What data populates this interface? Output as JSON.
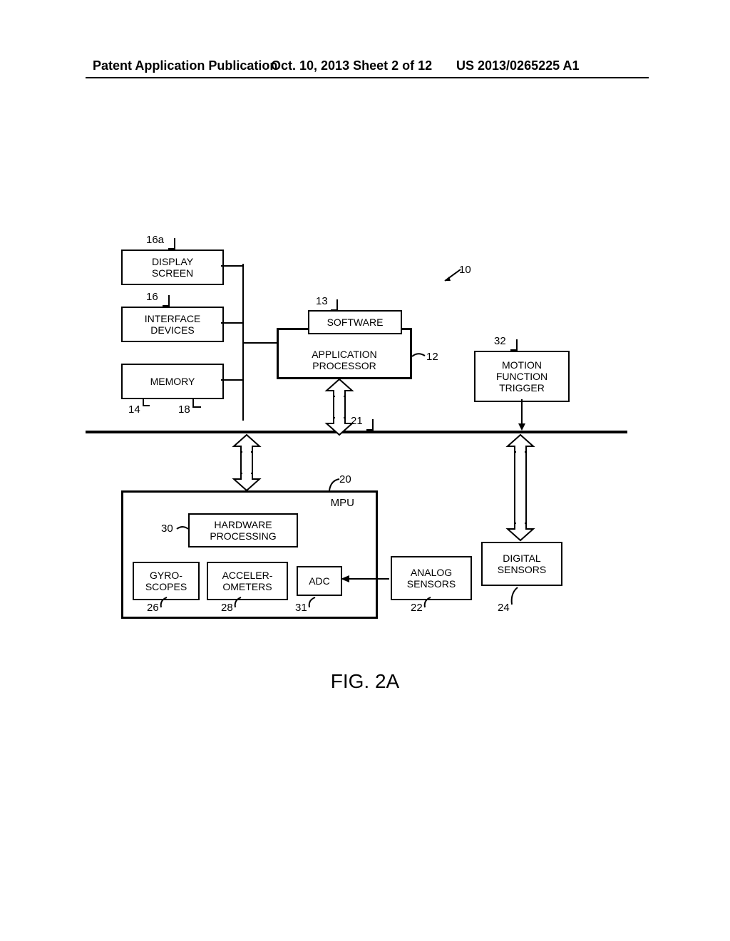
{
  "header": {
    "left": "Patent Application Publication",
    "center": "Oct. 10, 2013  Sheet 2 of 12",
    "right": "US 2013/0265225 A1"
  },
  "figure": {
    "caption": "FIG. 2A"
  },
  "blocks": {
    "display": "DISPLAY\nSCREEN",
    "interface": "INTERFACE\nDEVICES",
    "memory": "MEMORY",
    "software": "SOFTWARE",
    "appproc": "APPLICATION\nPROCESSOR",
    "motion": "MOTION\nFUNCTION\nTRIGGER",
    "mpu_title": "MPU",
    "hwproc": "HARDWARE\nPROCESSING",
    "gyros": "GYRO-\nSCOPES",
    "accel": "ACCELER-\nOMETERS",
    "adc": "ADC",
    "analog": "ANALOG\nSENSORS",
    "digital": "DIGITAL\nSENSORS"
  },
  "refs": {
    "r16a": "16a",
    "r16": "16",
    "r14": "14",
    "r18": "18",
    "r13": "13",
    "r12": "12",
    "r32": "32",
    "r10": "10",
    "r21": "21",
    "r20": "20",
    "r30": "30",
    "r26": "26",
    "r28": "28",
    "r31": "31",
    "r22": "22",
    "r24": "24"
  }
}
